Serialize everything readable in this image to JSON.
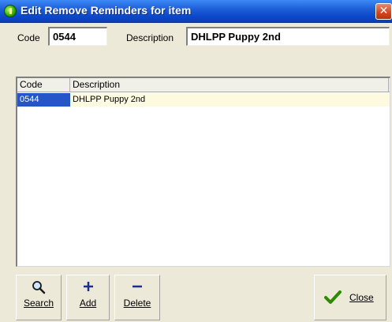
{
  "window": {
    "title": "Edit Remove Reminders for item",
    "close_glyph": "✕"
  },
  "form": {
    "code_label": "Code",
    "code_value": "0544",
    "description_label": "Description",
    "description_value": "DHLPP Puppy 2nd"
  },
  "grid": {
    "columns": [
      "Code",
      "Description"
    ],
    "rows": [
      {
        "code": "0544",
        "description": "DHLPP Puppy 2nd",
        "selected": true
      }
    ]
  },
  "toolbar": {
    "search_label": "Search",
    "add_label": "Add",
    "delete_label": "Delete",
    "close_label": "Close",
    "search_icon": "magnifier-icon",
    "add_icon": "plus-icon",
    "delete_icon": "minus-icon",
    "close_icon": "green-check-icon"
  },
  "colors": {
    "titlebar": "#1f5fd8",
    "selection": "#2456c8",
    "row_highlight": "#fdfae0",
    "check": "#2e8b00"
  }
}
